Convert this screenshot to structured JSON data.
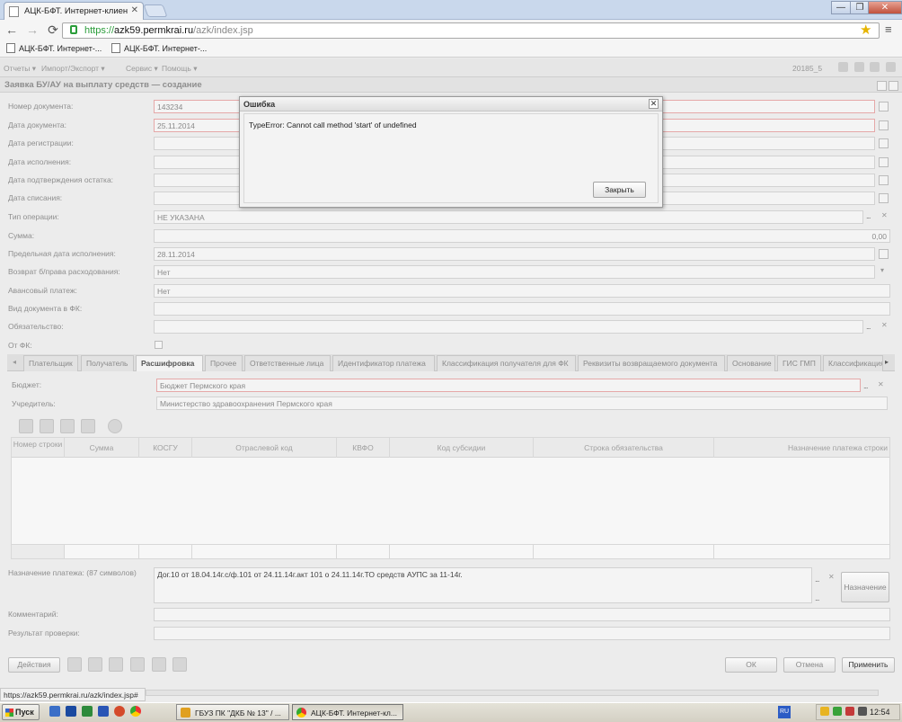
{
  "browser": {
    "tab_title": "АЦК-БФТ. Интернет-клиен",
    "new_tab_label": "",
    "url_prefix": "https://",
    "url_host": "azk59.permkrai.ru",
    "url_path": "/azk/index.jsp",
    "bookmarks": [
      "АЦК-БФТ. Интернет-...",
      "АЦК-БФТ. Интернет-..."
    ],
    "status_url": "https://azk59.permkrai.ru/azk/index.jsp#",
    "window_controls": {
      "minimize": "—",
      "restore": "❐",
      "close": "✕"
    }
  },
  "app_menu": {
    "items": [
      "Отчеты ▾",
      "Импорт/Экспорт ▾",
      "Сервис ▾",
      "Помощь ▾"
    ],
    "doc_counter": "20185_5"
  },
  "form": {
    "title": "Заявка БУ/АУ на выплату средств — создание",
    "fields": [
      {
        "label": "Номер документа:",
        "value": "143234"
      },
      {
        "label": "Дата документа:",
        "value": "25.11.2014"
      },
      {
        "label": "Дата регистрации:",
        "value": ""
      },
      {
        "label": "Дата исполнения:",
        "value": ""
      },
      {
        "label": "Дата подтверждения остатка:",
        "value": ""
      },
      {
        "label": "Дата списания:",
        "value": ""
      },
      {
        "label": "Тип операции:",
        "value": "НЕ УКАЗАНА"
      },
      {
        "label": "Сумма:",
        "value": "0,00"
      },
      {
        "label": "Предельная дата исполнения:",
        "value": "28.11.2014"
      },
      {
        "label": "Возврат б/права расходования:",
        "value": "Нет"
      },
      {
        "label": "Авансовый платеж:",
        "value": "Нет"
      },
      {
        "label": "Вид документа в ФК:",
        "value": ""
      },
      {
        "label": "Обязательство:",
        "value": ""
      },
      {
        "label": "От ФК:",
        "value": ""
      }
    ],
    "tabs": [
      "Плательщик",
      "Получатель",
      "Расшифровка",
      "Прочее",
      "Ответственные лица",
      "Идентификатор платежа",
      "Классификация получателя для ФК",
      "Реквизиты возвращаемого документа",
      "Основание",
      "ГИС ГМП",
      "Классификация"
    ],
    "active_tab": "Расшифровка",
    "budget_label": "Бюджет:",
    "budget_value": "Бюджет Пермского края",
    "founder_label": "Учредитель:",
    "founder_value": "Министерство здравоохранения Пермского края",
    "grid_columns": [
      "Номер строки",
      "Сумма",
      "КОСГУ",
      "Отраслевой код",
      "КВФО",
      "Код субсидии",
      "Строка обязательства",
      "Назначение платежа строки"
    ],
    "purpose_label": "Назначение платежа: (87 символов)",
    "purpose_value": "Дог.10 от 18.04.14г.с/ф.101 от 24.11.14г.акт 101 о 24.11.14г.ТО средств АУПС за 11-14г.",
    "purpose_button": "Назначение",
    "comment_label": "Комментарий:",
    "comment_value": "",
    "check_label": "Результат проверки:",
    "check_value": "",
    "actions_button": "Действия",
    "ok_button": "ОК",
    "cancel_button": "Отмена",
    "apply_button": "Применить",
    "ellipsis": "...",
    "clear": "✕",
    "dropdown": "▾"
  },
  "dialog": {
    "title": "Ошибка",
    "message": "TypeError: Cannot call method 'start' of undefined",
    "close_button": "Закрыть",
    "close_icon": "✕"
  },
  "taskbar": {
    "start_label": "Пуск",
    "tasks": [
      "ГБУЗ ПК \"ДКБ № 13\" / ...",
      "АЦК-БФТ. Интернет-кл..."
    ],
    "language": "RU",
    "clock": "12:54"
  },
  "colors": {
    "error_border": "#e5a8a8",
    "url_secure": "#2a9d3a",
    "taskbar": "#d4d0c4"
  }
}
